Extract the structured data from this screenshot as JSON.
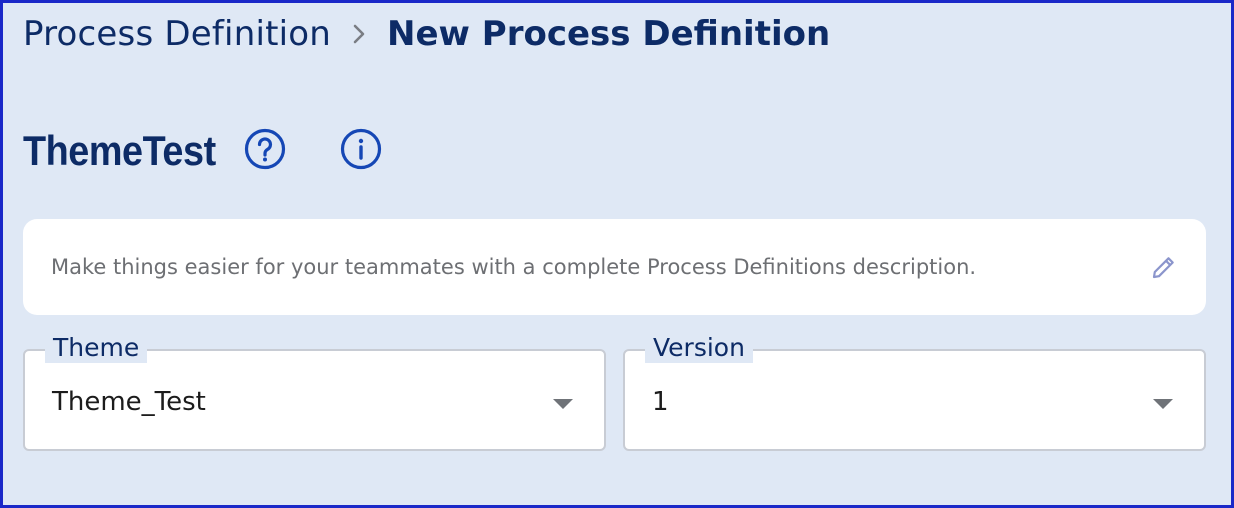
{
  "breadcrumb": {
    "parent": "Process Definition",
    "separator_icon": "chevron-right-icon",
    "current": "New Process Definition"
  },
  "header": {
    "title": "ThemeTest",
    "help_icon": "question-circle-icon",
    "info_icon": "info-circle-icon"
  },
  "description": {
    "placeholder": "Make things easier for your teammates with a complete Process Definitions description.",
    "edit_icon": "pencil-icon"
  },
  "fields": {
    "theme": {
      "label": "Theme",
      "value": "Theme_Test",
      "icon": "caret-down-icon"
    },
    "version": {
      "label": "Version",
      "value": "1",
      "icon": "caret-down-icon"
    }
  },
  "colors": {
    "background": "#dfe8f5",
    "primary": "#0d2b66",
    "accent_icon": "#1547b5",
    "border": "#1a28c8"
  }
}
